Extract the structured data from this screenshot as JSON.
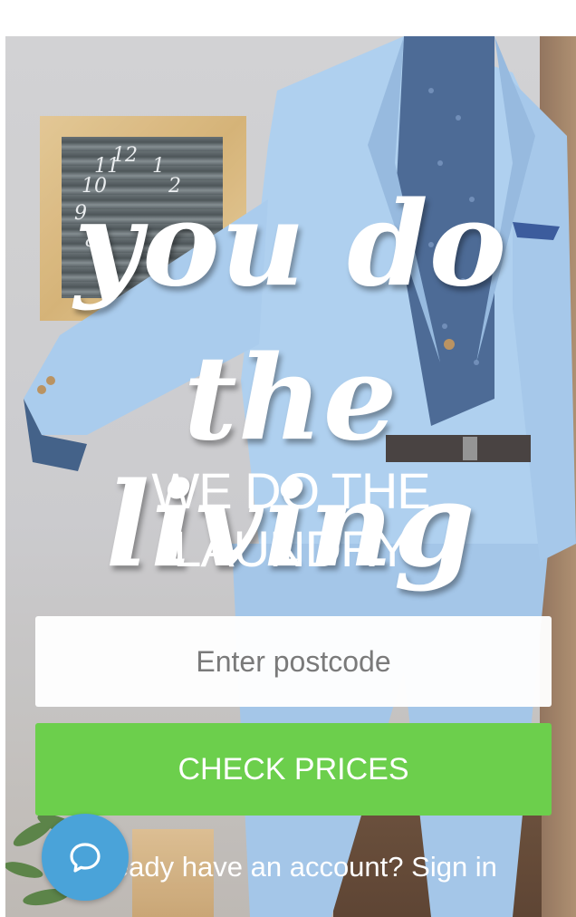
{
  "hero": {
    "script_line_1": "you do",
    "script_line_2": "the living",
    "subhead_line_1": "WE DO THE",
    "subhead_line_2": "LAUNDRY"
  },
  "form": {
    "postcode_placeholder": "Enter postcode",
    "postcode_value": "",
    "submit_label": "CHECK PRICES"
  },
  "account": {
    "prompt": "Already have an account?",
    "link_label": "Sign in"
  },
  "chat": {
    "icon": "chat-bubble-icon"
  },
  "colors": {
    "accent_green": "#6ccf4c",
    "chat_blue": "#4aa3d9",
    "text_white": "#ffffff"
  }
}
